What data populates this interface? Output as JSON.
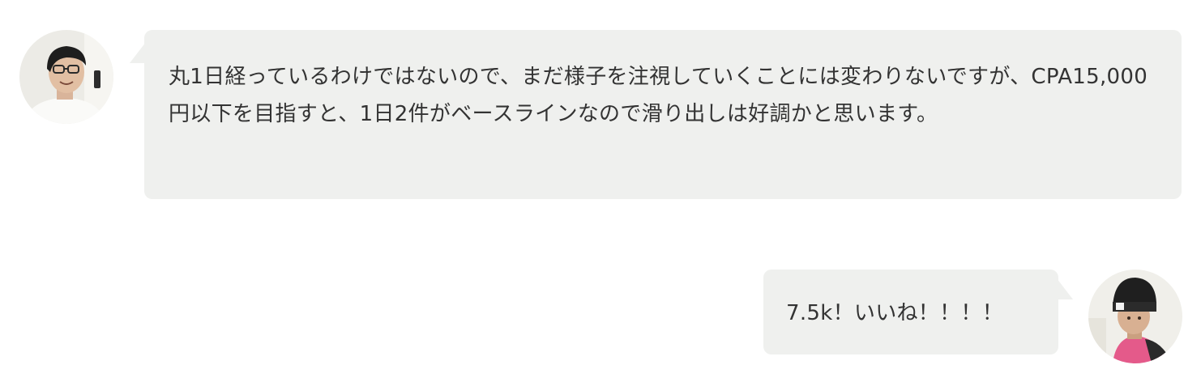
{
  "messages": [
    {
      "side": "left",
      "avatar": "man-with-glasses-avatar",
      "text": "丸1日経っているわけではないので、まだ様子を注視していくことには変わりないですが、CPA15,000円以下を目指すと、1日2件がベースラインなので滑り出しは好調かと思います。"
    },
    {
      "side": "right",
      "avatar": "man-with-black-beanie-avatar",
      "text": "7.5k！いいね！！！！"
    }
  ],
  "colors": {
    "bubble_background": "#eff0ee",
    "text": "#333333",
    "page_background": "#ffffff"
  }
}
